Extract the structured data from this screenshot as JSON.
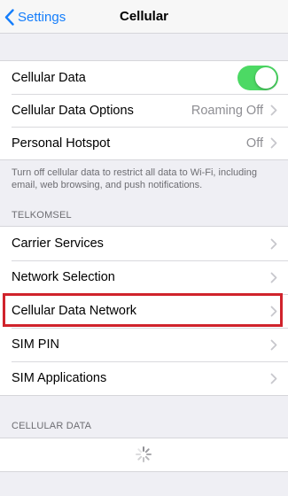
{
  "navbar": {
    "back_label": "Settings",
    "title": "Cellular"
  },
  "group1": {
    "rows": [
      {
        "label": "Cellular Data",
        "toggle_on": true
      },
      {
        "label": "Cellular Data Options",
        "value": "Roaming Off"
      },
      {
        "label": "Personal Hotspot",
        "value": "Off"
      }
    ],
    "footnote": "Turn off cellular data to restrict all data to Wi-Fi, including email, web browsing, and push notifications."
  },
  "section_carrier": {
    "header": "TELKOMSEL",
    "rows": [
      {
        "label": "Carrier Services"
      },
      {
        "label": "Network Selection"
      },
      {
        "label": "Cellular Data Network"
      },
      {
        "label": "SIM PIN"
      },
      {
        "label": "SIM Applications"
      }
    ]
  },
  "section_usage": {
    "header": "CELLULAR DATA"
  },
  "colors": {
    "accent": "#157efb",
    "toggle_on": "#4cd964",
    "highlight": "#d0232c"
  }
}
